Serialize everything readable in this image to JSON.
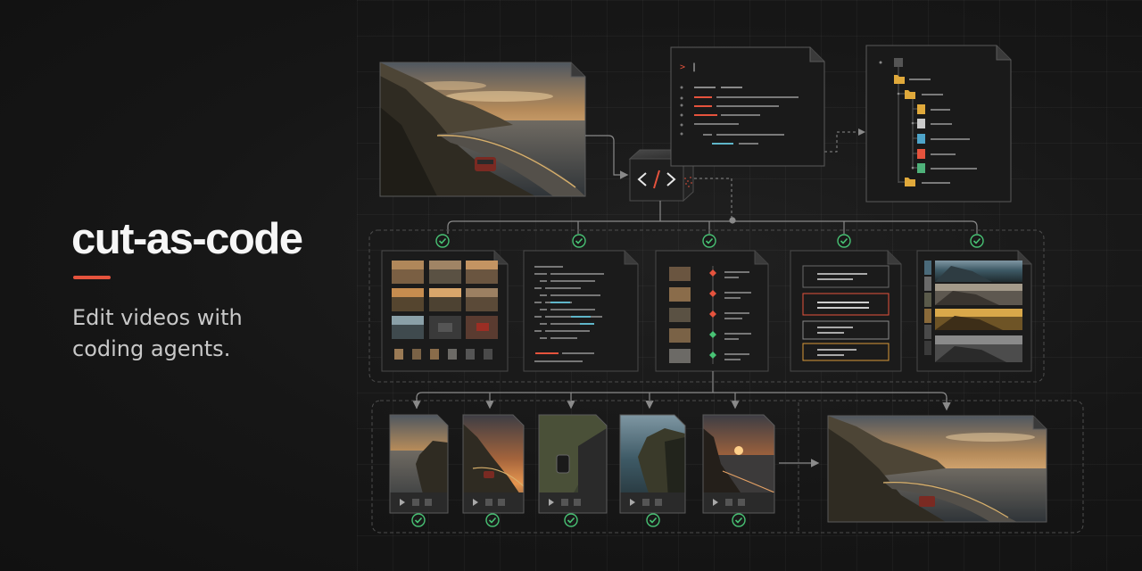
{
  "hero": {
    "title": "cut-as-code",
    "tagline": "Edit videos with coding agents."
  },
  "terminal": {
    "prompt": ">",
    "cursor": "|"
  },
  "colors": {
    "accent": "#e5533d",
    "check": "#48c274",
    "cyan": "#5fb6c9",
    "panel": "#1b1b1b",
    "panel_border": "#4a4a4a",
    "dashed": "#4d4d4d"
  },
  "icons": [
    "code-icon",
    "check-icon",
    "play-icon",
    "folder-icon",
    "file-icon",
    "arrow-icon"
  ]
}
